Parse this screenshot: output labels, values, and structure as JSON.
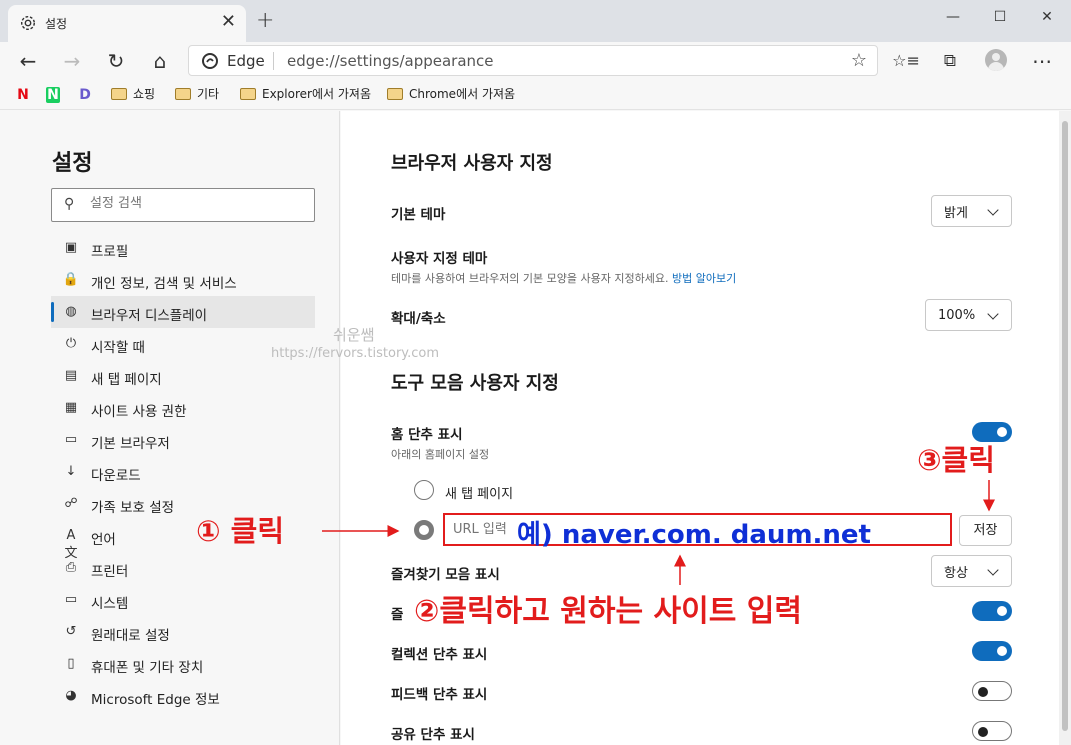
{
  "tab": {
    "title": "설정",
    "icon": "gear-icon",
    "close": "✕"
  },
  "new_tab": "+",
  "window_controls": {
    "minimize": "—",
    "maximize": "☐",
    "close": "✕"
  },
  "toolbar": {
    "back": "←",
    "forward": "→",
    "refresh": "↻",
    "home": "⌂",
    "address_label": "Edge",
    "address_url": "edge://settings/appearance",
    "favorite": "☆",
    "favorites_icon": "☆≡",
    "collections_icon": "⧉",
    "more": "⋯"
  },
  "bookmarks": [
    {
      "label": "쇼핑"
    },
    {
      "label": "기타"
    },
    {
      "label": "Explorer에서 가져옴"
    },
    {
      "label": "Chrome에서 가져옴"
    }
  ],
  "bookmark_logos": [
    "N",
    "N",
    "D"
  ],
  "sidebar": {
    "title": "설정",
    "search_placeholder": "설정 검색",
    "items": [
      {
        "label": "프로필",
        "icon": "profile-icon",
        "glyph": "▣"
      },
      {
        "label": "개인 정보, 검색 및 서비스",
        "icon": "lock-icon",
        "glyph": "🔒"
      },
      {
        "label": "브라우저 디스플레이",
        "icon": "palette-icon",
        "glyph": "◍",
        "selected": true
      },
      {
        "label": "시작할 때",
        "icon": "power-icon",
        "glyph": "⏻"
      },
      {
        "label": "새 탭 페이지",
        "icon": "newtab-icon",
        "glyph": "▤"
      },
      {
        "label": "사이트 사용 권한",
        "icon": "permissions-icon",
        "glyph": "▦"
      },
      {
        "label": "기본 브라우저",
        "icon": "browser-icon",
        "glyph": "▭"
      },
      {
        "label": "다운로드",
        "icon": "download-icon",
        "glyph": "↓"
      },
      {
        "label": "가족 보호 설정",
        "icon": "family-icon",
        "glyph": "☍"
      },
      {
        "label": "언어",
        "icon": "language-icon",
        "glyph": "A文"
      },
      {
        "label": "프린터",
        "icon": "printer-icon",
        "glyph": "⎙"
      },
      {
        "label": "시스템",
        "icon": "system-icon",
        "glyph": "▭"
      },
      {
        "label": "원래대로 설정",
        "icon": "reset-icon",
        "glyph": "↺"
      },
      {
        "label": "휴대폰 및 기타 장치",
        "icon": "phone-icon",
        "glyph": "▯"
      },
      {
        "label": "Microsoft Edge 정보",
        "icon": "edge-icon",
        "glyph": "◕"
      }
    ]
  },
  "main": {
    "section1_title": "브라우저 사용자 지정",
    "default_theme_label": "기본 테마",
    "default_theme_value": "밝게",
    "custom_theme_label": "사용자 지정 테마",
    "custom_theme_desc": "테마를 사용하여 브라우저의 기본 모양을 사용자 지정하세요.",
    "custom_theme_link": "방법 알아보기",
    "zoom_label": "확대/축소",
    "zoom_value": "100%",
    "section2_title": "도구 모음 사용자 지정",
    "home_button_label": "홈 단추 표시",
    "home_button_desc": "아래의 홈페이지 설정",
    "home_button_on": true,
    "radio_newtab_label": "새 탭 페이지",
    "url_placeholder": "URL 입력",
    "save_label": "저장",
    "favorites_bar_label": "즐겨찾기 모음 표시",
    "favorites_bar_value": "항상",
    "favorites_button_label": "즐",
    "favorites_button_on": true,
    "collections_label": "컬렉션 단추 표시",
    "collections_on": true,
    "feedback_label": "피드백 단추 표시",
    "feedback_on": false,
    "share_label": "공유 단추 표시",
    "share_on": false
  },
  "annotations": {
    "step1": "① 클릭",
    "step2": "②클릭하고 원하는 사이트 입력",
    "step3": "③클릭",
    "example": "예) naver.com. daum.net"
  },
  "watermark": {
    "name": "쉬운쌤",
    "url": "https://fervors.tistory.com"
  },
  "colors": {
    "accent": "#0f6cbd",
    "annotation_red": "#e21c1c",
    "annotation_blue": "#0f2fd6"
  }
}
